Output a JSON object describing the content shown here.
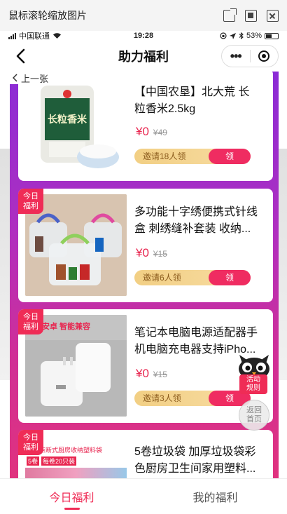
{
  "viewer": {
    "title": "鼠标滚轮缩放图片"
  },
  "status_bar": {
    "carrier": "中国联通",
    "time": "19:28",
    "battery": "53%",
    "battery_level": 0.53
  },
  "nav": {
    "title": "助力福利"
  },
  "prev_link": "上一张",
  "products": [
    {
      "title": "【中国农垦】北大荒 长粒香米2.5kg",
      "price": "¥0",
      "original_price": "¥49",
      "invite": "邀请18人领",
      "claim": "领",
      "badge": ""
    },
    {
      "title": "多功能十字绣便携式针线盒 刺绣缝补套装 收纳...",
      "price": "¥0",
      "original_price": "¥15",
      "invite": "邀请6人领",
      "claim": "领",
      "badge": "今日\n福利"
    },
    {
      "title": "笔记本电脑电源适配器手机电脑充电器支持iPho...",
      "price": "¥0",
      "original_price": "¥15",
      "invite": "邀请3人领",
      "claim": "领",
      "badge": "今日\n福利"
    },
    {
      "title": "5卷垃圾袋 加厚垃圾袋彩色厨房卫生间家用塑料...",
      "price": "",
      "original_price": "",
      "invite": "",
      "claim": "",
      "badge": "今日\n福利"
    }
  ],
  "thumb_text": {
    "rice_brand": "长粒香米",
    "charger_headline": "苹果安卓 智能兼容",
    "bag_line1": "家用点断式厨房收纳塑料袋",
    "bag_line2": "5卷",
    "bag_line3": "每卷20只装"
  },
  "floating": {
    "rules": "活动\n规则",
    "home": "返回\n首页"
  },
  "tabs": [
    {
      "label": "今日福利",
      "active": true
    },
    {
      "label": "我的福利",
      "active": false
    }
  ],
  "colors": {
    "accent": "#ef2c56",
    "gradient_top": "#8a2bd6",
    "gradient_bottom": "#e0327e",
    "invite_gold": "#f2cf84"
  }
}
